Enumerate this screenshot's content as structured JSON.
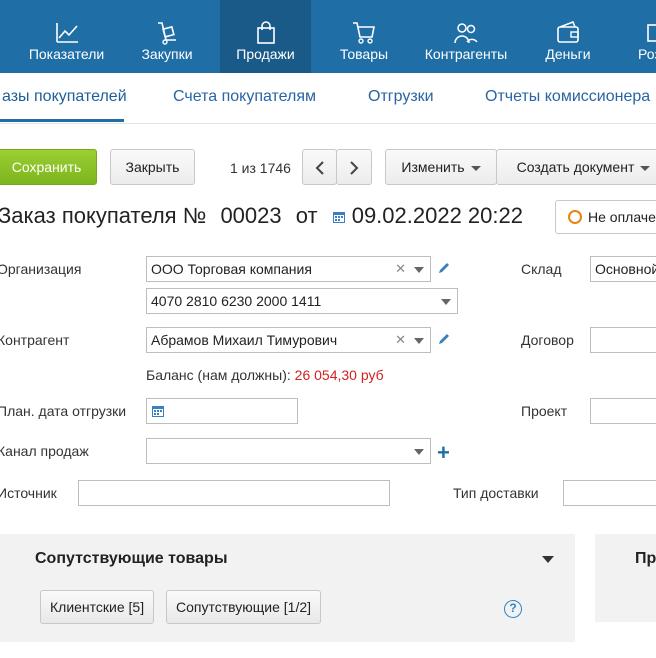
{
  "nav": {
    "items": [
      {
        "label": "Показатели",
        "icon": "chart-icon"
      },
      {
        "label": "Закупки",
        "icon": "dolly-icon"
      },
      {
        "label": "Продажи",
        "icon": "shopping-bag-icon"
      },
      {
        "label": "Товары",
        "icon": "cart-icon"
      },
      {
        "label": "Контрагенты",
        "icon": "people-icon"
      },
      {
        "label": "Деньги",
        "icon": "wallet-icon"
      },
      {
        "label": "Роз",
        "icon": "retail-icon"
      }
    ],
    "active": "Продажи"
  },
  "tabs": [
    "азы покупателей",
    "Счета покупателям",
    "Отгрузки",
    "Отчеты комиссионера"
  ],
  "toolbar": {
    "save": "Сохранить",
    "close": "Закрыть",
    "pager": "1 из 1746",
    "change": "Изменить",
    "create_doc": "Создать документ"
  },
  "doc": {
    "title_prefix": "Заказ покупателя №",
    "number": "00023",
    "from": "от",
    "datetime": "09.02.2022 20:22",
    "status": "Не оплачен"
  },
  "form": {
    "org_label": "Организация",
    "org_value": "ООО Торговая компания",
    "account_value": "4070 2810 6230 2000 1411",
    "warehouse_label": "Склад",
    "warehouse_value": "Основной склад",
    "counterparty_label": "Контрагент",
    "counterparty_value": "Абрамов Михаил Тимурович",
    "contract_label": "Договор",
    "balance_label": "Баланс (нам должны):",
    "balance_value": "26 054,30 руб",
    "ship_date_label": "План. дата отгрузки",
    "project_label": "Проект",
    "channel_label": "Канал продаж",
    "source_label": "Источник",
    "delivery_label": "Тип доставки"
  },
  "related": {
    "title": "Сопутствующие товары",
    "btn_clients": "Клиентские [5]",
    "btn_related": "Сопутствующие [1/2]",
    "help": "?",
    "right_title": "Пр"
  },
  "colors": {
    "nav_bg": "#1f6ea6",
    "save_green": "#8cc428",
    "negative": "#d42020",
    "status_orange": "#e8850c"
  }
}
